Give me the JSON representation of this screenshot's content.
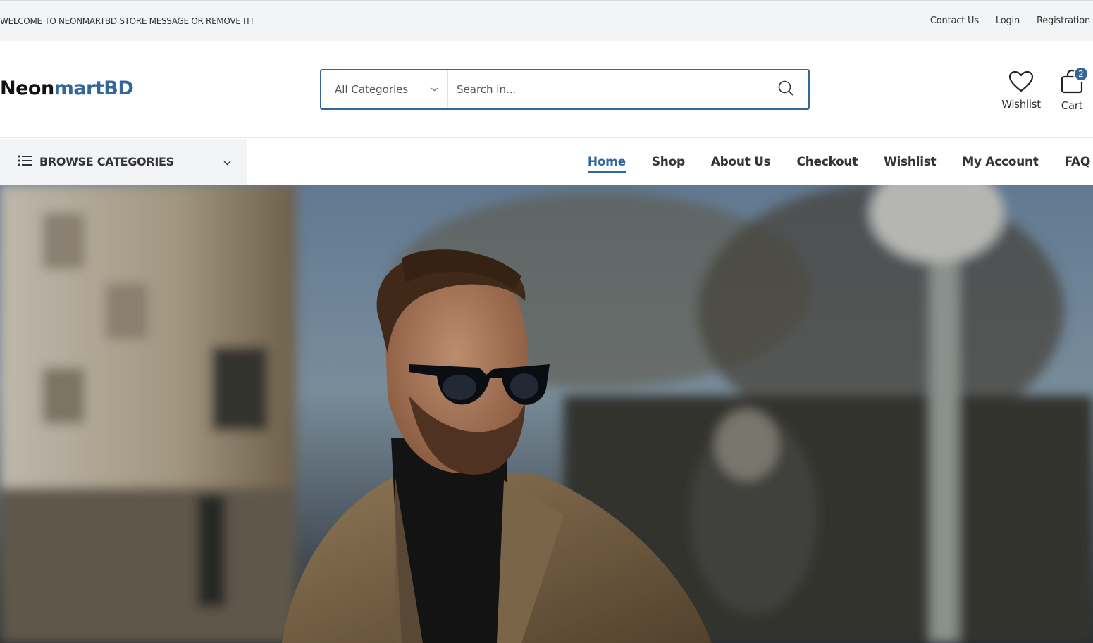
{
  "topbar": {
    "welcome": "WELCOME TO NEONMARTBD STORE MESSAGE OR REMOVE IT!",
    "links": [
      "Contact Us",
      "Login",
      "Registration"
    ]
  },
  "brand": {
    "part1": "Neon",
    "part2": "martBD",
    "accent_color": "#336699"
  },
  "search": {
    "category": "All Categories",
    "placeholder": "Search in..."
  },
  "header_icons": {
    "wishlist_label": "Wishlist",
    "cart_label": "Cart",
    "cart_count": "2"
  },
  "browse": {
    "label": "BROWSE CATEGORIES"
  },
  "nav": {
    "items": [
      "Home",
      "Shop",
      "About Us",
      "Checkout",
      "Wishlist",
      "My Account",
      "FAQ"
    ],
    "active": "Home"
  },
  "hero": {
    "image": "man-in-glasses-and-coat-on-street"
  }
}
